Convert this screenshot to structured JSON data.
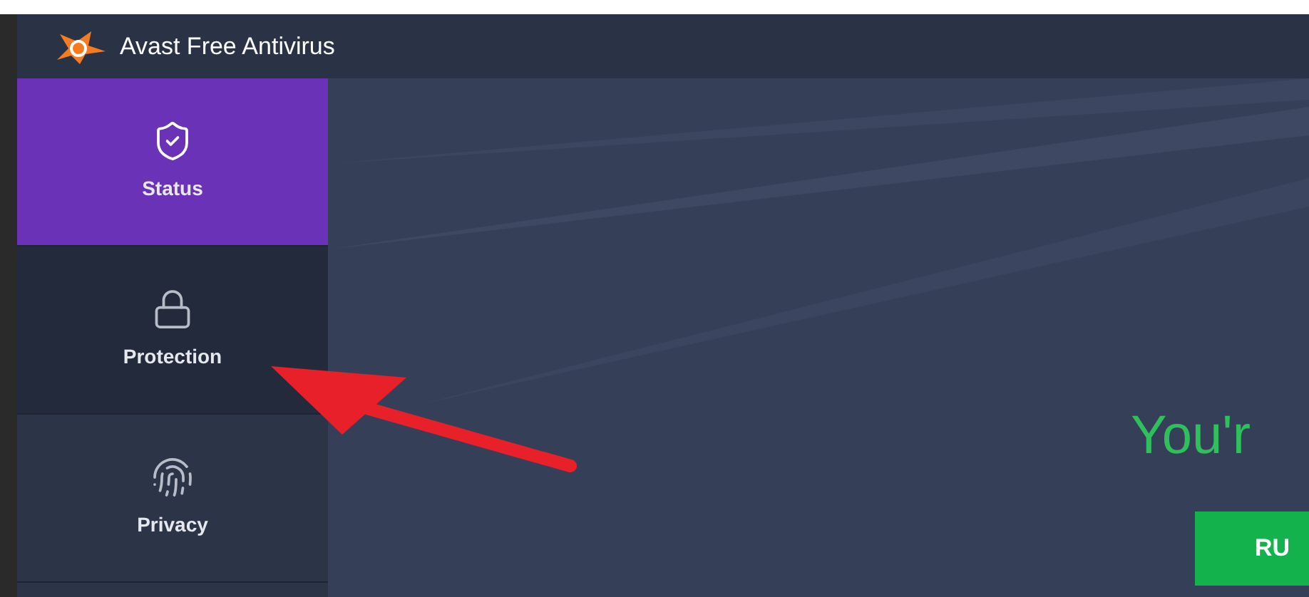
{
  "window": {
    "title": "Avast Free Antivirus"
  },
  "sidebar": {
    "items": [
      {
        "label": "Status",
        "kind": "shield",
        "selected": true,
        "hovered": false
      },
      {
        "label": "Protection",
        "kind": "lock",
        "selected": false,
        "hovered": true
      },
      {
        "label": "Privacy",
        "kind": "fingerprint",
        "selected": false,
        "hovered": false
      }
    ]
  },
  "main": {
    "headline": "You'r",
    "button": "RU"
  }
}
